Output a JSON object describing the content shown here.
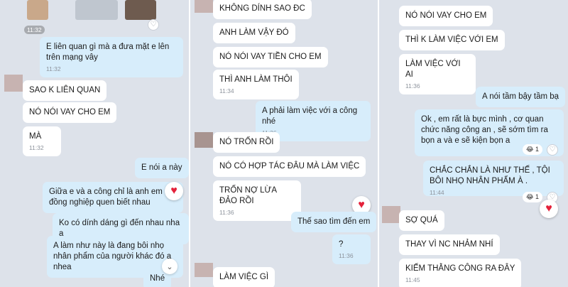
{
  "panel1": {
    "photo_time": "11:32",
    "msg1": {
      "text": "E liên quan gì mà a đưa mặt e lên trên mạng vây",
      "time": "11:32"
    },
    "msg2": {
      "text": "SAO K LIÊN QUAN"
    },
    "msg3": {
      "text": "NÓ NÓI VAY CHO EM"
    },
    "msg4": {
      "text": "MÀ",
      "time": "11:32"
    },
    "msg5": {
      "text": "E nói a này"
    },
    "msg6": {
      "text": "Giữa e và a công chỉ là anh em đồng nghiệp quen biết nhau"
    },
    "msg7": {
      "text": "Ko có dính dáng gì đến nhau nha a"
    },
    "msg8": {
      "text": "A làm như này là đang bôi nhọ nhân phẩm của người khác đó a nhea"
    },
    "msg9": {
      "text": "Nhé"
    }
  },
  "panel2": {
    "msg1": {
      "text": "KHÔNG DÍNH SAO ĐC"
    },
    "msg2": {
      "text": "ANH LÀM VẬY ĐÓ"
    },
    "msg3": {
      "text": "NÓ NÓI VAY TIỀN CHO EM"
    },
    "msg4": {
      "text": "THÌ ANH LÀM THÔI",
      "time": "11:34"
    },
    "msg5": {
      "text": "A phải làm việc với a công nhé",
      "time": "11:36"
    },
    "msg6": {
      "text": "NÓ TRỐN RỒI"
    },
    "msg7": {
      "text": "NÓ CÓ HỢP TÁC ĐÂU MÀ LÀM VIỆC"
    },
    "msg8": {
      "text": "TRỐN NỢ LỪA ĐẢO RỒI",
      "time": "11:36"
    },
    "msg9": {
      "text": "Thế sao tìm đến em"
    },
    "msg10": {
      "text": "?",
      "time": "11:36"
    },
    "msg11": {
      "text": "LÀM VIỆC GÌ"
    }
  },
  "panel3": {
    "msg1": {
      "text": "NÓ NÓI VAY CHO EM"
    },
    "msg2": {
      "text": "THÌ K LÀM VIỆC VỚI EM"
    },
    "msg3": {
      "text": "LÀM VIỆC VỚI AI",
      "time": "11:36"
    },
    "msg4": {
      "text": "A nói tầm bậy tầm bạ"
    },
    "msg5": {
      "text": "Ok , em rất là bực mình , cơ quan chức năng công an , sẽ sớm tìm ra bọn a và e sẽ kiện bọn a",
      "reaction_count": "1"
    },
    "msg6": {
      "text": "CHẮC CHẮN LÀ NHƯ THẾ , TỘI BÔI NHỌ NHÂN PHẨM À .",
      "time": "11:44",
      "reaction_count": "1"
    },
    "msg7": {
      "text": "SỢ QUÁ"
    },
    "msg8": {
      "text": "THAY VÌ NC NHẢM NHÍ"
    },
    "msg9": {
      "text": "KIẾM THẰNG CÔNG RA ĐÂY",
      "time": "11:45"
    }
  },
  "icons": {
    "heart": "♥",
    "empty_heart": "♡",
    "chevron": "⌄",
    "emoji": "😂"
  },
  "colors": {
    "panel_bg": "#dde2ea",
    "incoming": "#ffffff",
    "outgoing": "#d7edfb",
    "heart": "#e4213a"
  }
}
